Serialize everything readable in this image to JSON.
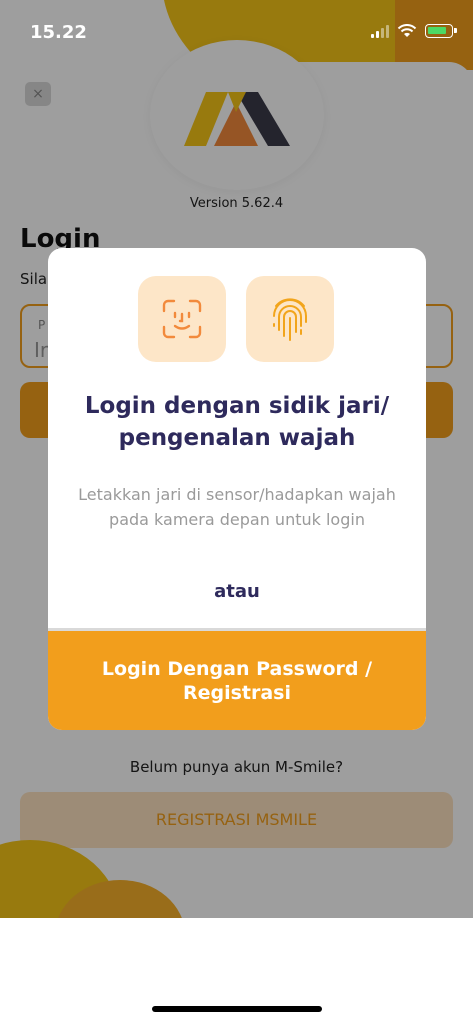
{
  "status_bar": {
    "time": "15.22"
  },
  "background": {
    "version": "Version 5.62.4",
    "login_title": "Login",
    "login_subtitle": "Sila",
    "field_label": "P",
    "field_value": "Ir",
    "no_account_text": "Belum punya akun M-Smile?",
    "register_label": "REGISTRASI MSMILE",
    "close_symbol": "×"
  },
  "modal": {
    "title": "Login dengan sidik jari/ pengenalan wajah",
    "description": "Letakkan jari di sensor/hadapkan wajah pada kamera depan untuk login",
    "or_text": "atau",
    "password_button_label": "Login Dengan Password / Registrasi",
    "icons": [
      "face-id-icon",
      "fingerprint-icon"
    ]
  },
  "colors": {
    "accent": "#f29e1c",
    "brand_yellow": "#f5c518",
    "title_navy": "#2e2a5c",
    "tile_bg": "#fde6c8",
    "face_icon": "#f28a3c",
    "fingerprint_icon": "#f2a51c"
  }
}
